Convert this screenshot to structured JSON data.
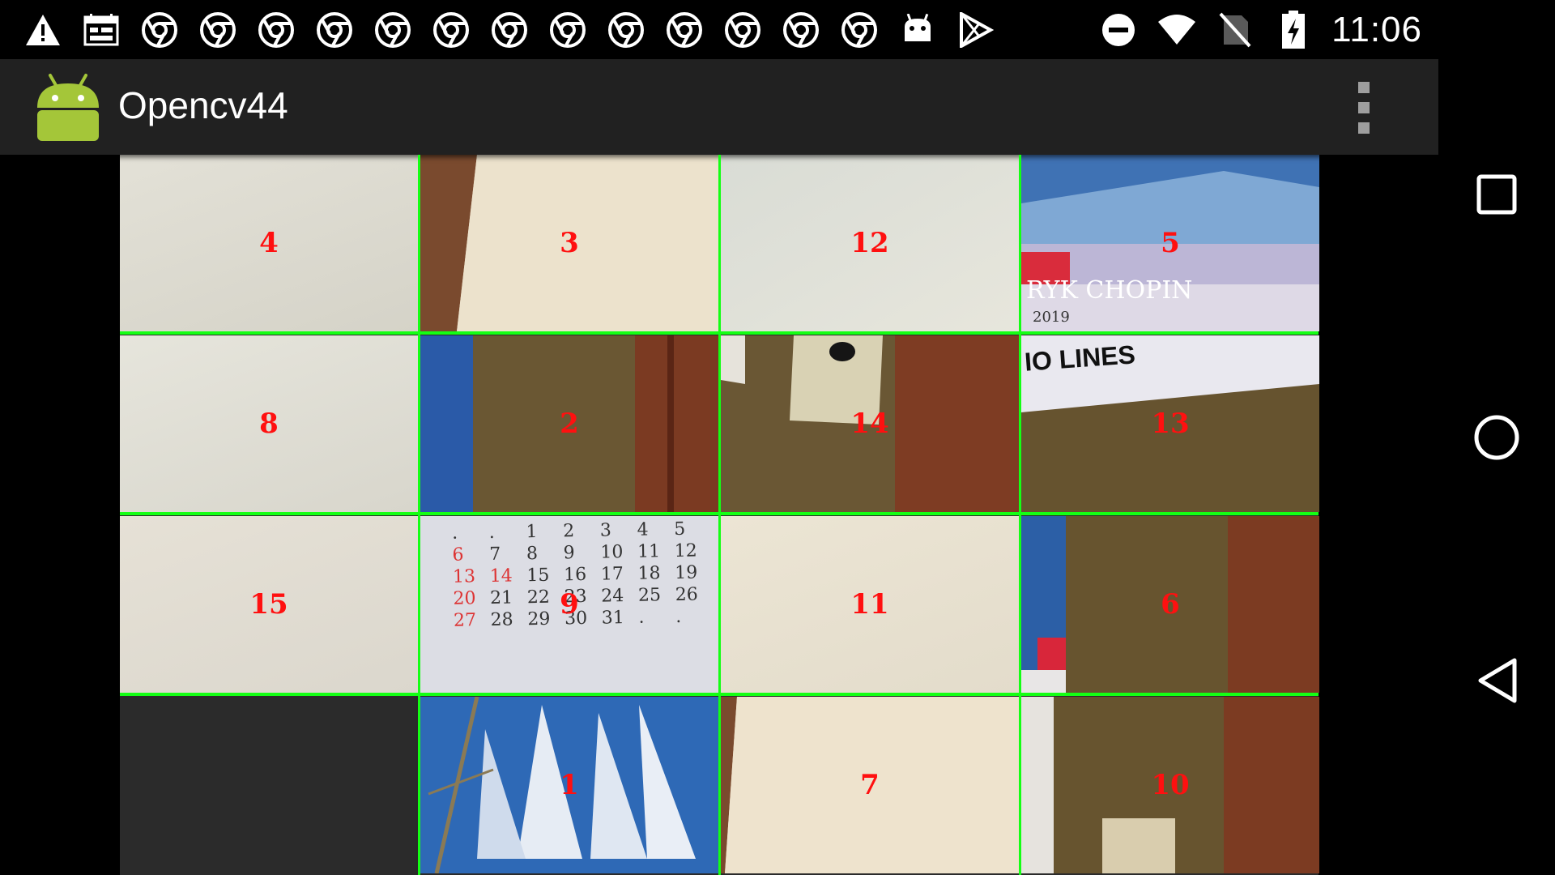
{
  "status_bar": {
    "notification_icons": [
      "warning-icon",
      "calendar-icon",
      "chrome-icon",
      "chrome-icon",
      "chrome-icon",
      "chrome-icon",
      "chrome-icon",
      "chrome-icon",
      "chrome-icon",
      "chrome-icon",
      "chrome-icon",
      "chrome-icon",
      "chrome-icon",
      "chrome-icon",
      "chrome-icon",
      "android-debug-icon",
      "play-store-icon"
    ],
    "system_icons": [
      "do-not-disturb-icon",
      "wifi-icon",
      "no-sim-icon",
      "battery-charging-icon"
    ],
    "time": "11:06"
  },
  "action_bar": {
    "title": "Opencv44",
    "overflow_icon": "more-vert-icon"
  },
  "puzzle": {
    "rows": 4,
    "cols": 4,
    "tiles": [
      {
        "label": "4"
      },
      {
        "label": "3"
      },
      {
        "label": "12"
      },
      {
        "label": "5"
      },
      {
        "label": "8"
      },
      {
        "label": "2"
      },
      {
        "label": "14"
      },
      {
        "label": "13"
      },
      {
        "label": "15"
      },
      {
        "label": "9"
      },
      {
        "label": "11"
      },
      {
        "label": "6"
      },
      {
        "label": ""
      },
      {
        "label": "1"
      },
      {
        "label": "7"
      },
      {
        "label": "10"
      }
    ],
    "empty_tile_index": 12,
    "label_color": "#ff1010",
    "grid_color": "#14ff14"
  },
  "photo_text": {
    "poster_name": "RYK CHOPIN",
    "poster_year": "2019",
    "lines_text": "IO LINES",
    "calendar_rows": [
      [
        ".",
        ".",
        "1",
        "2",
        "3",
        "4",
        "5"
      ],
      [
        "6",
        "7",
        "8",
        "9",
        "10",
        "11",
        "12"
      ],
      [
        "13",
        "14",
        "15",
        "16",
        "17",
        "18",
        "19"
      ],
      [
        "20",
        "21",
        "22",
        "23",
        "24",
        "25",
        "26"
      ],
      [
        "27",
        "28",
        "29",
        "30",
        "31",
        ".",
        "."
      ]
    ]
  },
  "nav_bar": {
    "buttons": [
      "recents-icon",
      "home-icon",
      "back-icon"
    ]
  }
}
